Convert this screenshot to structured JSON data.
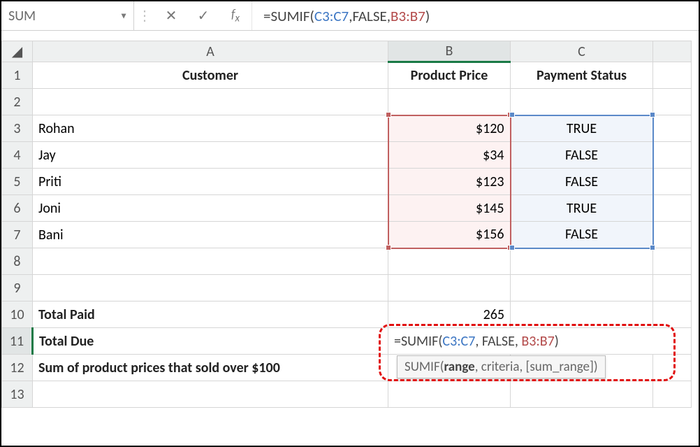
{
  "formula_bar": {
    "name_box": "SUM",
    "formula_parts": {
      "eq": "=",
      "fn": "SUMIF",
      "open": "(",
      "range1": "C3:C7",
      "sep1": ", ",
      "criteria": "FALSE",
      "sep2": ", ",
      "range2": "B3:B7",
      "close": ")"
    }
  },
  "columns": {
    "A": "A",
    "B": "B",
    "C": "C"
  },
  "headers": {
    "r1": {
      "A": "Customer",
      "B": "Product Price",
      "C": "Payment Status"
    }
  },
  "rows": {
    "r3": {
      "A": "Rohan",
      "B": "$120",
      "C": "TRUE"
    },
    "r4": {
      "A": "Jay",
      "B": "$34",
      "C": "FALSE"
    },
    "r5": {
      "A": "Priti",
      "B": "$123",
      "C": "FALSE"
    },
    "r6": {
      "A": "Joni",
      "B": "$145",
      "C": "TRUE"
    },
    "r7": {
      "A": "Bani",
      "B": "$156",
      "C": "FALSE"
    }
  },
  "r10": {
    "A": "Total Paid",
    "B": "265"
  },
  "r11": {
    "A": "Total Due",
    "formula": {
      "eq": "=",
      "fn": "SUMIF",
      "open": "(",
      "range1": "C3:C7",
      "sep1": ", ",
      "criteria": "FALSE",
      "sep2": ", ",
      "range2": "B3:B7",
      "close": ")"
    }
  },
  "r12": {
    "A": "Sum of product prices that sold over $100"
  },
  "tooltip": {
    "fn": "SUMIF",
    "open": "(",
    "p1": "range",
    "s1": ", ",
    "p2": "criteria",
    "s2": ", ",
    "p3": "[sum_range]",
    "close": ")"
  },
  "row_labels": {
    "1": "1",
    "2": "2",
    "3": "3",
    "4": "4",
    "5": "5",
    "6": "6",
    "7": "7",
    "8": "8",
    "9": "9",
    "10": "10",
    "11": "11",
    "12": "12",
    "13": "13"
  }
}
